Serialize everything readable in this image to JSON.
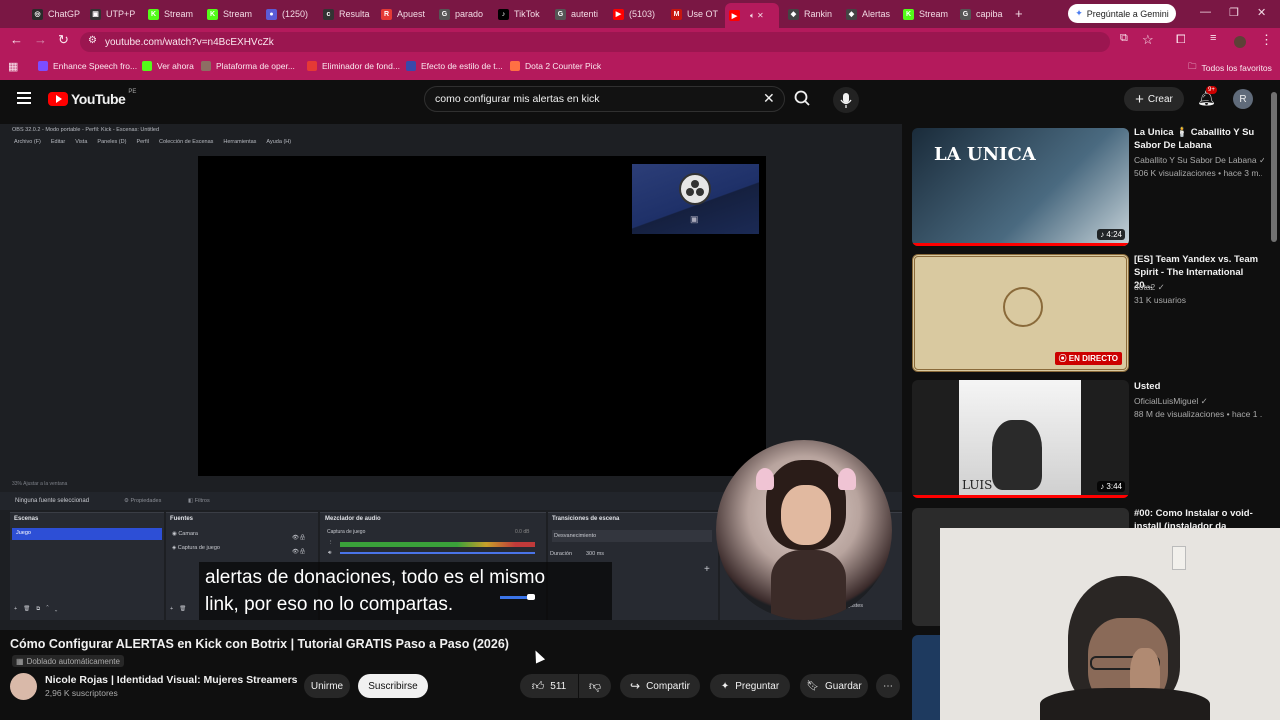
{
  "browser": {
    "tabs": [
      {
        "label": "ChatGP",
        "color": "#2a2a2a",
        "glyph": "◎"
      },
      {
        "label": "UTP+P",
        "color": "#333",
        "glyph": "▣"
      },
      {
        "label": "Stream",
        "color": "#53fc18",
        "glyph": "K"
      },
      {
        "label": "Stream",
        "color": "#53fc18",
        "glyph": "K"
      },
      {
        "label": "(1250)",
        "color": "#5b5bd6",
        "glyph": "●"
      },
      {
        "label": "Resulta",
        "color": "#333",
        "glyph": "c"
      },
      {
        "label": "Apuest",
        "color": "#e53935",
        "glyph": "R"
      },
      {
        "label": "parado",
        "color": "#555",
        "glyph": "G"
      },
      {
        "label": "TikTok",
        "color": "#000",
        "glyph": "♪"
      },
      {
        "label": "autenti",
        "color": "#555",
        "glyph": "G"
      },
      {
        "label": "(5103)",
        "color": "#ff0000",
        "glyph": "▶"
      },
      {
        "label": "Use OT",
        "color": "#c71610",
        "glyph": "M"
      },
      {
        "label": "",
        "color": "#ff0000",
        "glyph": "▶"
      },
      {
        "label": "Rankin",
        "color": "#444",
        "glyph": "◆"
      },
      {
        "label": "Alertas",
        "color": "#444",
        "glyph": "◆"
      },
      {
        "label": "Stream",
        "color": "#53fc18",
        "glyph": "K"
      },
      {
        "label": "capiba",
        "color": "#555",
        "glyph": "G"
      }
    ],
    "gemini_label": "Pregúntale a Gemini",
    "url": "youtube.com/watch?v=n4BcEXHVcZk",
    "bookmarks": [
      {
        "label": "Enhance Speech fro...",
        "color": "#7c4dff"
      },
      {
        "label": "Ver ahora",
        "color": "#53fc18"
      },
      {
        "label": "Plataforma de oper...",
        "color": "#8d6e63"
      },
      {
        "label": "Eliminador de fond...",
        "color": "#e53935"
      },
      {
        "label": "Efecto de estilo de t...",
        "color": "#3949ab"
      },
      {
        "label": "Dota 2 Counter Pick",
        "color": "#ff7043"
      }
    ],
    "all_favorites": "Todos los favoritos"
  },
  "youtube": {
    "logo": "YouTube",
    "country": "PE",
    "search_query": "como configurar mis alertas en kick",
    "create_label": "Crear",
    "notif_badge": "9+",
    "avatar_letter": "R"
  },
  "obs": {
    "window_title": "OBS 32.0.2 - Modo portable - Perfil: Kick - Escenas: Untitled",
    "menu": [
      "Archivo (F)",
      "Editar",
      "Vista",
      "Paneles (D)",
      "Perfil",
      "Colección de Escenas",
      "Herramientas",
      "Ayuda (H)"
    ],
    "status": "33%      Ajustar a la ventana",
    "no_source": "Ninguna fuente seleccionad",
    "properties": "Propiedades",
    "filters": "Filtros",
    "scenes_header": "Escenas",
    "scene_item": "Juego",
    "sources_header": "Fuentes",
    "sources": [
      "Camara",
      "Captura de juego"
    ],
    "mixer_header": "Mezclador de audio",
    "mixer_item": "Captura de juego",
    "mixer_db": "0.0 dB",
    "transitions_header": "Transiciones de escena",
    "transition_value": "Desvanecimiento",
    "duration_label": "Duración",
    "duration_value": "300 ms",
    "settings_label": "Ajustes"
  },
  "video": {
    "caption_line1": "alertas de donaciones, todo es el mismo",
    "caption_line2": "link, por eso no lo compartas.",
    "title": "Cómo Configurar ALERTAS en Kick con Botrix | Tutorial GRATIS Paso a Paso (2026)",
    "dubbed": "Doblado automáticamente",
    "channel": "Nicole Rojas | Identidad Visual: Mujeres Streamers",
    "subscribers": "2,96 K suscriptores",
    "join_label": "Unirme",
    "subscribe_label": "Suscribirse",
    "likes": "511",
    "share_label": "Compartir",
    "ask_label": "Preguntar",
    "save_label": "Guardar"
  },
  "sidebar": [
    {
      "title": "La Unica 🕯️ Caballito Y Su Sabor De Labana",
      "channel": "Caballito Y Su Sabor De Labana",
      "meta": "506 K visualizaciones • hace 3 m...",
      "duration": "4:24",
      "thumb_text": "LA UNICA",
      "verified": true
    },
    {
      "title": "[ES] Team Yandex vs. Team Spirit - The International 20...",
      "channel": "dota2",
      "meta": "31 K usuarios",
      "live": "EN DIRECTO",
      "verified": true
    },
    {
      "title": "Usted",
      "channel": "OficialLuisMiguel",
      "meta": "88 M de visualizaciones • hace 1 ...",
      "duration": "3:44",
      "thumb_text": "LUIS",
      "verified": true
    },
    {
      "title": "#00: Como Instalar o void-install (instalador da",
      "channel": "",
      "meta": ""
    }
  ]
}
